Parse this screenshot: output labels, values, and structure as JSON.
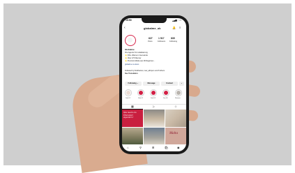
{
  "status_bar": {
    "time": "15:50",
    "icons": "▂▄▆ ◔ ▭"
  },
  "header": {
    "back": "‹",
    "username": "globalme_uk",
    "bell": "🔔",
    "menu": "≡"
  },
  "profile": {
    "stats": [
      {
        "num": "627",
        "label": "Posts"
      },
      {
        "num": "1 517",
        "label": "Followers"
      },
      {
        "num": "835",
        "label": "Following"
      }
    ],
    "name": "Globalme",
    "bio_lines": [
      "Ihre Agentur für Lokalisierung",
      "⭐ 300+ Wanne in Gemeinde",
      "⭐ Über 170 Wenner",
      "⭐ Premium-Marke aus 90 Regionen...",
      "globalme.co.uk/en",
      "Followed by lizabbarnet, new_alimpen und 8 others",
      "See Translation"
    ]
  },
  "buttons": {
    "following": "Following ⌄",
    "message": "Message",
    "contact": "Contact",
    "more": "⌄"
  },
  "highlights": [
    "Deal 01",
    "Dela 01",
    "Deal 03",
    "Des 06",
    "Reviews"
  ],
  "tabs": {
    "grid": "▦",
    "reels": "▷",
    "tagged": "☺"
  },
  "tiles": {
    "t1_text": "Was macht ein Übersetzer eigentlich?",
    "t4_text": "Malta"
  },
  "bottom_nav": {
    "home": "⌂",
    "search": "⚲",
    "add": "⊞",
    "shop": "🛍",
    "profile": "◉"
  },
  "colors": {
    "brand_red": "#d21f44",
    "background": "#cfcfcf",
    "phone_frame": "#1a1a1a"
  }
}
